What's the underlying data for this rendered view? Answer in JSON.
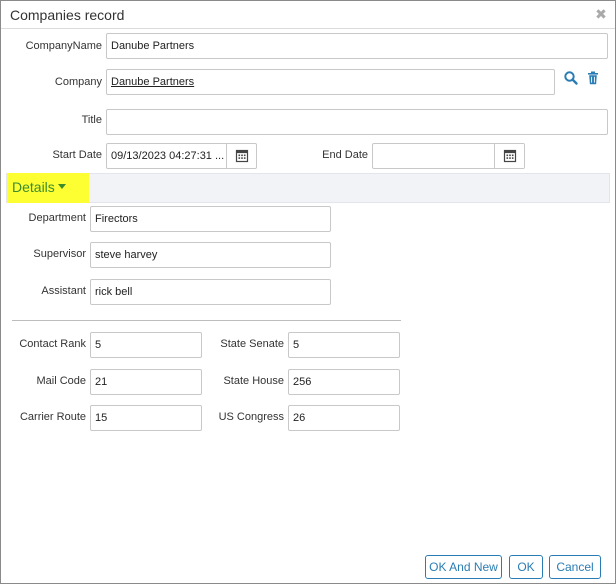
{
  "dialog": {
    "title": "Companies record",
    "close_glyph": "✖"
  },
  "fields": {
    "company_name": {
      "label": "CompanyName",
      "value": "Danube Partners"
    },
    "company": {
      "label": "Company",
      "value": "Danube Partners"
    },
    "title": {
      "label": "Title",
      "value": ""
    },
    "start_date": {
      "label": "Start Date",
      "value": "09/13/2023 04:27:31 ..."
    },
    "end_date": {
      "label": "End Date",
      "value": ""
    }
  },
  "details": {
    "section_label": "Details",
    "department": {
      "label": "Department",
      "value": "Firectors"
    },
    "supervisor": {
      "label": "Supervisor",
      "value": "steve harvey"
    },
    "assistant": {
      "label": "Assistant",
      "value": "rick bell"
    },
    "contact_rank": {
      "label": "Contact Rank",
      "value": "5"
    },
    "mail_code": {
      "label": "Mail Code",
      "value": "21"
    },
    "carrier_route": {
      "label": "Carrier Route",
      "value": "15"
    },
    "state_senate": {
      "label": "State Senate",
      "value": "5"
    },
    "state_house": {
      "label": "State House",
      "value": "256"
    },
    "us_congress": {
      "label": "US Congress",
      "value": "26"
    }
  },
  "buttons": {
    "ok_and_new": "OK And New",
    "ok": "OK",
    "cancel": "Cancel"
  },
  "colors": {
    "accent": "#2a7db4",
    "section_highlight": "#fdff32",
    "section_text": "#3c8c2e"
  },
  "icons": {
    "search": "search-icon",
    "trash": "trash-icon",
    "calendar": "calendar-icon",
    "close": "close-icon",
    "caret": "caret-down-icon"
  }
}
